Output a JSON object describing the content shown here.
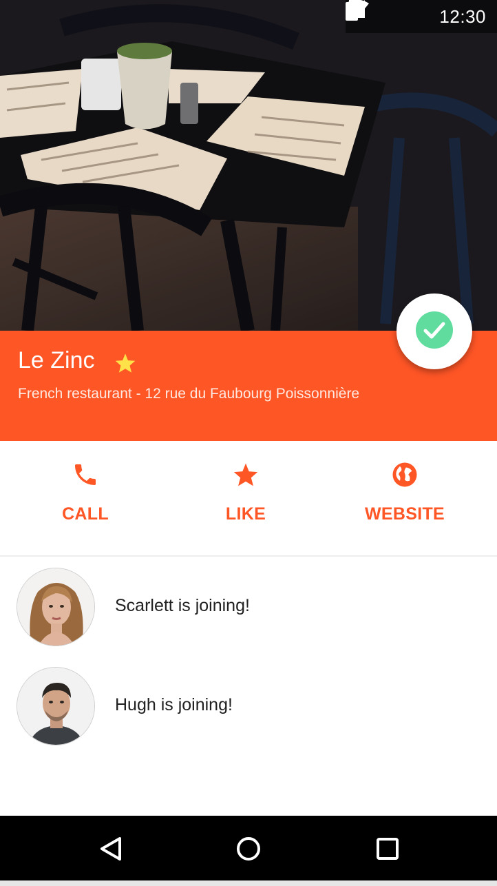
{
  "status_bar": {
    "time": "12:30",
    "icons": [
      "wifi-icon",
      "cell-signal-icon",
      "battery-icon"
    ]
  },
  "hero": {
    "image": "restaurant-tables-photo"
  },
  "place": {
    "name": "Le Zinc",
    "subtitle": "French restaurant - 12 rue du Faubourg Poissonnière",
    "favorite_icon": "star-icon",
    "status_icon": "check-circle-icon"
  },
  "actions": [
    {
      "label": "CALL",
      "icon": "phone-icon"
    },
    {
      "label": "LIKE",
      "icon": "star-icon"
    },
    {
      "label": "WEBSITE",
      "icon": "globe-icon"
    }
  ],
  "attendees": [
    {
      "text": "Scarlett is joining!",
      "avatar": "avatar-scarlett"
    },
    {
      "text": "Hugh is joining!",
      "avatar": "avatar-hugh"
    }
  ],
  "nav": {
    "buttons": [
      "back-icon",
      "home-icon",
      "recents-icon"
    ]
  },
  "colors": {
    "accent": "#ff5626",
    "check_green": "#5fdc9e",
    "star_yellow": "#ffe14a",
    "navbar": "#000000"
  }
}
